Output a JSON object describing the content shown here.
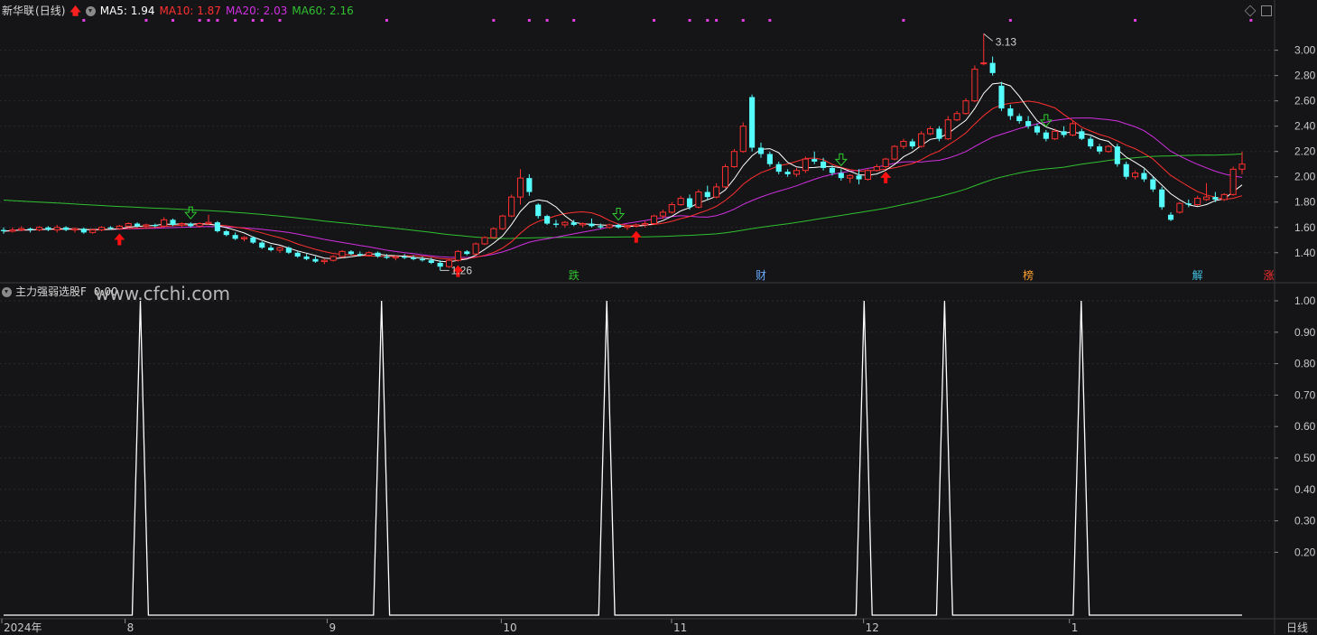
{
  "stock": {
    "name": "新华联",
    "period_label": "(日线)"
  },
  "ma_labels": {
    "ma5": {
      "text": "MA5: 1.94",
      "color": "#ffffff"
    },
    "ma10": {
      "text": "MA10: 1.87",
      "color": "#ff3030"
    },
    "ma20": {
      "text": "MA20: 2.03",
      "color": "#d030e0"
    },
    "ma60": {
      "text": "MA60: 2.16",
      "color": "#30c030"
    }
  },
  "indicator": {
    "name": "主力强弱选股F",
    "value": "0.00"
  },
  "watermark": "www.cfchi.com",
  "period_button": "日线",
  "chart_data": {
    "type": "candlestick",
    "price_axis": {
      "ticks": [
        "3.00",
        "2.80",
        "2.60",
        "2.40",
        "2.20",
        "2.00",
        "1.80",
        "1.60",
        "1.40"
      ],
      "range": [
        1.17,
        3.24
      ]
    },
    "indicator_axis": {
      "ticks": [
        "1.00",
        "0.90",
        "0.80",
        "0.70",
        "0.60",
        "0.50",
        "0.40",
        "0.30",
        "0.20"
      ],
      "range": [
        0,
        1.0
      ]
    },
    "x_axis_labels": [
      "2024年",
      "8",
      "9",
      "10",
      "11",
      "12",
      "1"
    ],
    "annotations": [
      {
        "text": "3.13",
        "type": "high",
        "price": 3.13
      },
      {
        "text": "1.26",
        "type": "low",
        "price": 1.26
      }
    ],
    "event_badges": [
      {
        "text": "跌",
        "color": "#30c030"
      },
      {
        "text": "财",
        "color": "#6aaaff"
      },
      {
        "text": "榜",
        "color": "#ffa030"
      },
      {
        "text": "解",
        "color": "#40c0e0"
      },
      {
        "text": "涨",
        "color": "#ff3030"
      }
    ],
    "colors": {
      "up": "#ff3030",
      "down": "#54fcfc",
      "ma5": "#ffffff",
      "ma10": "#ff3030",
      "ma20": "#d030e0",
      "ma60": "#30c030",
      "signal_dot": "#e040e0",
      "buy": "#ff1010",
      "sell": "#30d030",
      "indicator": "#ffffff"
    },
    "candles": [
      [
        1.58,
        1.6,
        1.55,
        1.57
      ],
      [
        1.57,
        1.6,
        1.56,
        1.58
      ],
      [
        1.58,
        1.61,
        1.57,
        1.59
      ],
      [
        1.59,
        1.6,
        1.56,
        1.58
      ],
      [
        1.58,
        1.61,
        1.57,
        1.6
      ],
      [
        1.6,
        1.61,
        1.57,
        1.58
      ],
      [
        1.58,
        1.62,
        1.56,
        1.6
      ],
      [
        1.6,
        1.61,
        1.57,
        1.58
      ],
      [
        1.58,
        1.6,
        1.56,
        1.59
      ],
      [
        1.59,
        1.6,
        1.55,
        1.56
      ],
      [
        1.56,
        1.59,
        1.55,
        1.58
      ],
      [
        1.58,
        1.61,
        1.57,
        1.6
      ],
      [
        1.6,
        1.61,
        1.58,
        1.59
      ],
      [
        1.59,
        1.62,
        1.58,
        1.61
      ],
      [
        1.61,
        1.64,
        1.6,
        1.63
      ],
      [
        1.63,
        1.64,
        1.6,
        1.61
      ],
      [
        1.61,
        1.63,
        1.59,
        1.62
      ],
      [
        1.62,
        1.63,
        1.6,
        1.61
      ],
      [
        1.61,
        1.68,
        1.6,
        1.66
      ],
      [
        1.66,
        1.67,
        1.61,
        1.62
      ],
      [
        1.62,
        1.64,
        1.6,
        1.63
      ],
      [
        1.63,
        1.64,
        1.6,
        1.61
      ],
      [
        1.61,
        1.64,
        1.6,
        1.63
      ],
      [
        1.63,
        1.7,
        1.62,
        1.64
      ],
      [
        1.64,
        1.65,
        1.56,
        1.57
      ],
      [
        1.57,
        1.58,
        1.53,
        1.54
      ],
      [
        1.54,
        1.56,
        1.5,
        1.51
      ],
      [
        1.51,
        1.53,
        1.49,
        1.52
      ],
      [
        1.52,
        1.53,
        1.47,
        1.48
      ],
      [
        1.48,
        1.49,
        1.43,
        1.44
      ],
      [
        1.44,
        1.46,
        1.41,
        1.42
      ],
      [
        1.42,
        1.45,
        1.4,
        1.44
      ],
      [
        1.44,
        1.45,
        1.39,
        1.4
      ],
      [
        1.4,
        1.41,
        1.36,
        1.37
      ],
      [
        1.37,
        1.39,
        1.34,
        1.35
      ],
      [
        1.35,
        1.37,
        1.32,
        1.33
      ],
      [
        1.33,
        1.35,
        1.31,
        1.34
      ],
      [
        1.34,
        1.38,
        1.33,
        1.37
      ],
      [
        1.37,
        1.42,
        1.36,
        1.41
      ],
      [
        1.41,
        1.42,
        1.38,
        1.39
      ],
      [
        1.39,
        1.41,
        1.37,
        1.38
      ],
      [
        1.38,
        1.41,
        1.37,
        1.4
      ],
      [
        1.4,
        1.41,
        1.36,
        1.37
      ],
      [
        1.37,
        1.39,
        1.35,
        1.36
      ],
      [
        1.36,
        1.38,
        1.34,
        1.37
      ],
      [
        1.37,
        1.39,
        1.35,
        1.36
      ],
      [
        1.36,
        1.38,
        1.34,
        1.35
      ],
      [
        1.35,
        1.37,
        1.33,
        1.34
      ],
      [
        1.34,
        1.36,
        1.31,
        1.32
      ],
      [
        1.32,
        1.34,
        1.26,
        1.29
      ],
      [
        1.29,
        1.35,
        1.28,
        1.34
      ],
      [
        1.34,
        1.42,
        1.33,
        1.41
      ],
      [
        1.41,
        1.42,
        1.38,
        1.39
      ],
      [
        1.39,
        1.48,
        1.38,
        1.47
      ],
      [
        1.47,
        1.53,
        1.46,
        1.52
      ],
      [
        1.52,
        1.6,
        1.51,
        1.59
      ],
      [
        1.59,
        1.7,
        1.58,
        1.69
      ],
      [
        1.69,
        1.86,
        1.68,
        1.84
      ],
      [
        1.84,
        2.06,
        1.78,
        1.99
      ],
      [
        1.99,
        2.02,
        1.85,
        1.88
      ],
      [
        1.78,
        1.79,
        1.67,
        1.69
      ],
      [
        1.69,
        1.7,
        1.62,
        1.63
      ],
      [
        1.63,
        1.66,
        1.6,
        1.62
      ],
      [
        1.62,
        1.65,
        1.6,
        1.64
      ],
      [
        1.64,
        1.66,
        1.61,
        1.62
      ],
      [
        1.62,
        1.64,
        1.6,
        1.63
      ],
      [
        1.63,
        1.67,
        1.6,
        1.61
      ],
      [
        1.61,
        1.63,
        1.59,
        1.6
      ],
      [
        1.6,
        1.63,
        1.59,
        1.62
      ],
      [
        1.62,
        1.63,
        1.59,
        1.6
      ],
      [
        1.6,
        1.62,
        1.58,
        1.61
      ],
      [
        1.61,
        1.63,
        1.6,
        1.62
      ],
      [
        1.62,
        1.65,
        1.6,
        1.63
      ],
      [
        1.63,
        1.7,
        1.62,
        1.69
      ],
      [
        1.69,
        1.74,
        1.67,
        1.72
      ],
      [
        1.72,
        1.8,
        1.71,
        1.78
      ],
      [
        1.78,
        1.85,
        1.77,
        1.83
      ],
      [
        1.83,
        1.86,
        1.74,
        1.76
      ],
      [
        1.76,
        1.9,
        1.75,
        1.88
      ],
      [
        1.88,
        1.93,
        1.82,
        1.84
      ],
      [
        1.84,
        1.95,
        1.83,
        1.92
      ],
      [
        1.92,
        2.1,
        1.91,
        2.08
      ],
      [
        2.08,
        2.22,
        2.07,
        2.2
      ],
      [
        2.2,
        2.43,
        2.19,
        2.4
      ],
      [
        2.63,
        2.65,
        2.2,
        2.23
      ],
      [
        2.23,
        2.27,
        2.15,
        2.18
      ],
      [
        2.18,
        2.2,
        2.08,
        2.1
      ],
      [
        2.1,
        2.12,
        2.02,
        2.04
      ],
      [
        2.04,
        2.06,
        2.0,
        2.02
      ],
      [
        2.02,
        2.07,
        2.0,
        2.05
      ],
      [
        2.05,
        2.16,
        2.03,
        2.14
      ],
      [
        2.14,
        2.2,
        2.1,
        2.12
      ],
      [
        2.12,
        2.15,
        2.05,
        2.07
      ],
      [
        2.07,
        2.09,
        2.01,
        2.03
      ],
      [
        2.03,
        2.06,
        1.97,
        1.99
      ],
      [
        1.99,
        2.02,
        1.95,
        2.01
      ],
      [
        2.01,
        2.06,
        1.94,
        1.98
      ],
      [
        1.98,
        2.06,
        1.97,
        2.05
      ],
      [
        2.05,
        2.1,
        2.04,
        2.08
      ],
      [
        2.08,
        2.15,
        2.07,
        2.14
      ],
      [
        2.14,
        2.25,
        2.13,
        2.24
      ],
      [
        2.24,
        2.3,
        2.22,
        2.28
      ],
      [
        2.28,
        2.3,
        2.22,
        2.24
      ],
      [
        2.24,
        2.36,
        2.23,
        2.34
      ],
      [
        2.34,
        2.4,
        2.33,
        2.38
      ],
      [
        2.38,
        2.4,
        2.28,
        2.3
      ],
      [
        2.3,
        2.48,
        2.29,
        2.45
      ],
      [
        2.45,
        2.52,
        2.44,
        2.5
      ],
      [
        2.5,
        2.62,
        2.49,
        2.6
      ],
      [
        2.6,
        2.88,
        2.59,
        2.85
      ],
      [
        2.9,
        3.13,
        2.88,
        2.9
      ],
      [
        2.9,
        2.95,
        2.8,
        2.82
      ],
      [
        2.72,
        2.75,
        2.52,
        2.54
      ],
      [
        2.54,
        2.57,
        2.45,
        2.48
      ],
      [
        2.48,
        2.5,
        2.42,
        2.44
      ],
      [
        2.44,
        2.48,
        2.38,
        2.4
      ],
      [
        2.4,
        2.42,
        2.33,
        2.35
      ],
      [
        2.35,
        2.37,
        2.28,
        2.3
      ],
      [
        2.3,
        2.38,
        2.29,
        2.36
      ],
      [
        2.36,
        2.4,
        2.31,
        2.33
      ],
      [
        2.33,
        2.44,
        2.32,
        2.42
      ],
      [
        2.36,
        2.38,
        2.29,
        2.3
      ],
      [
        2.3,
        2.32,
        2.22,
        2.24
      ],
      [
        2.24,
        2.26,
        2.18,
        2.2
      ],
      [
        2.2,
        2.25,
        2.19,
        2.24
      ],
      [
        2.24,
        2.26,
        2.08,
        2.1
      ],
      [
        2.1,
        2.12,
        1.98,
        2.0
      ],
      [
        2.0,
        2.05,
        1.98,
        2.03
      ],
      [
        2.03,
        2.06,
        1.96,
        1.98
      ],
      [
        1.98,
        2.0,
        1.88,
        1.9
      ],
      [
        1.9,
        1.92,
        1.74,
        1.76
      ],
      [
        1.7,
        1.72,
        1.65,
        1.66
      ],
      [
        1.72,
        1.8,
        1.71,
        1.79
      ],
      [
        1.79,
        1.82,
        1.76,
        1.78
      ],
      [
        1.78,
        1.85,
        1.77,
        1.83
      ],
      [
        1.82,
        1.95,
        1.81,
        1.84
      ],
      [
        1.84,
        1.88,
        1.8,
        1.82
      ],
      [
        1.82,
        1.87,
        1.81,
        1.86
      ],
      [
        1.86,
        2.08,
        1.85,
        2.06
      ],
      [
        2.06,
        2.2,
        2.02,
        2.1
      ]
    ],
    "buy_signals": [
      13,
      51,
      71,
      99
    ],
    "sell_signals": [
      21,
      69,
      94,
      117
    ],
    "signal_dots": [
      9,
      16,
      19,
      22,
      23,
      24,
      26,
      28,
      29,
      31,
      43,
      55,
      59,
      61,
      64,
      73,
      77,
      79,
      80,
      83,
      86,
      101,
      113,
      127,
      140
    ],
    "indicator_values": [
      0,
      0,
      0,
      0,
      0,
      0,
      0,
      0,
      0,
      0,
      0,
      0,
      0,
      0,
      0,
      0,
      0,
      1,
      0,
      0,
      0,
      0,
      0,
      0,
      0,
      0,
      0,
      0,
      0,
      0,
      0,
      0,
      0,
      0,
      0,
      0,
      0,
      0,
      0,
      0,
      0,
      0,
      0,
      0,
      0,
      0,
      0,
      1,
      0,
      0,
      0,
      0,
      0,
      0,
      0,
      0,
      0,
      0,
      0,
      0,
      0,
      0,
      0,
      0,
      0,
      0,
      0,
      0,
      0,
      0,
      0,
      0,
      0,
      0,
      0,
      1,
      0,
      0,
      0,
      0,
      0,
      0,
      0,
      0,
      0,
      0,
      0,
      0,
      0,
      0,
      0,
      0,
      0,
      0,
      0,
      0,
      0,
      0,
      0,
      0,
      0,
      0,
      0,
      0,
      0,
      0,
      0,
      1,
      0,
      0,
      0,
      0,
      0,
      0,
      0,
      0,
      0,
      1,
      0,
      0,
      0,
      0,
      0,
      0,
      0,
      0,
      0,
      0,
      0,
      0,
      0,
      0,
      0,
      0,
      1,
      0,
      0,
      0,
      0,
      0,
      0,
      0,
      0,
      0,
      0,
      0,
      0,
      0,
      0,
      0,
      0,
      0,
      0,
      0,
      0
    ]
  }
}
